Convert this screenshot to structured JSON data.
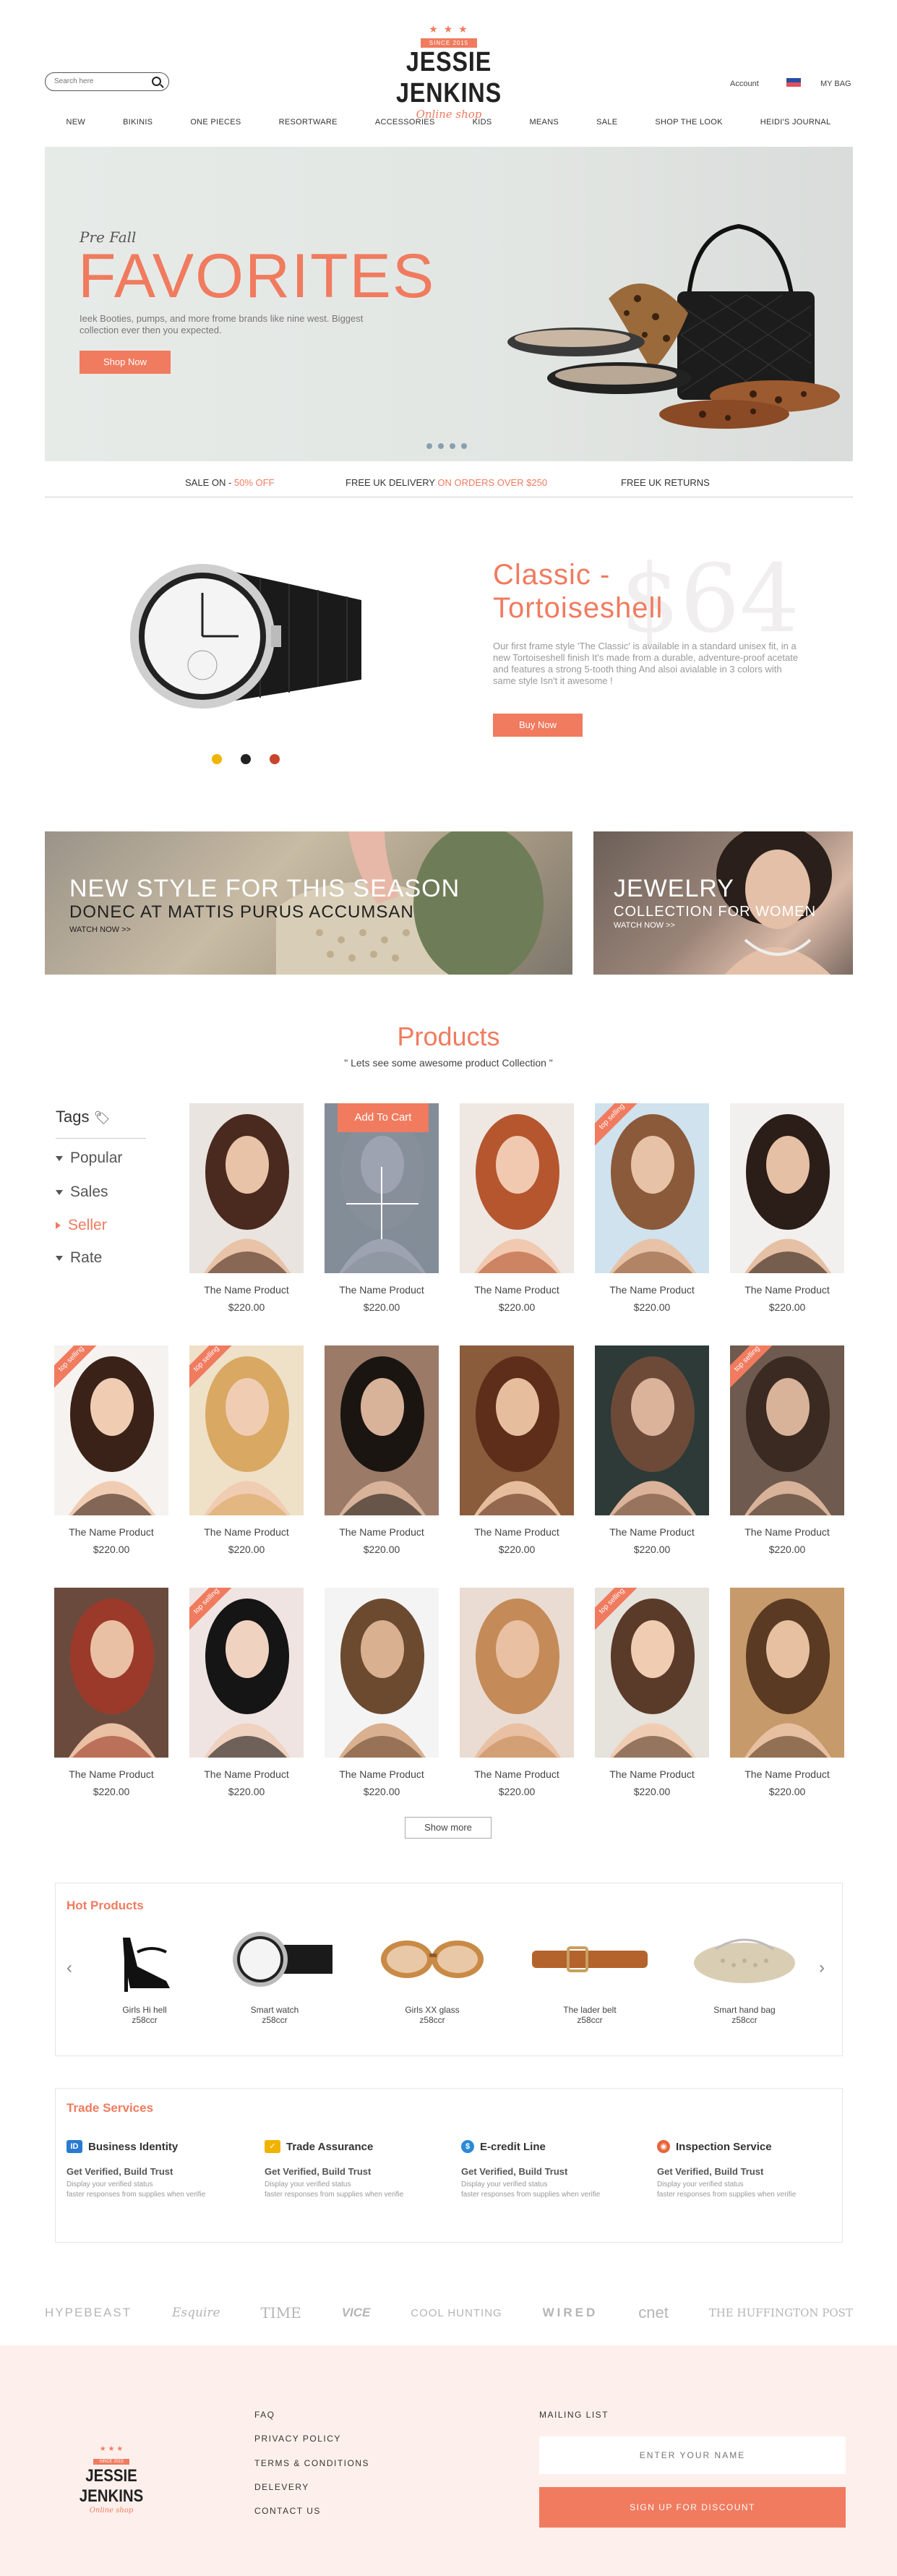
{
  "header": {
    "search_placeholder": "Search here",
    "logo": {
      "ribbon": "SINCE 2015",
      "name": "JESSIE JENKINS",
      "sub": "Online shop"
    },
    "account": "Account",
    "my_bag": "MY BAG"
  },
  "nav": [
    "NEW",
    "BIKINIS",
    "ONE PIECES",
    "RESORTWARE",
    "ACCESSORIES",
    "KIDS",
    "MEANS",
    "SALE",
    "SHOP THE LOOK",
    "HEIDI'S JOURNAL"
  ],
  "hero": {
    "pre": "Pre Fall",
    "title": "FAVORITES",
    "desc": "Ieek Booties, pumps, and more frome brands like nine west. Biggest collection ever then you expected.",
    "cta": "Shop Now"
  },
  "strip": {
    "sale_label": "SALE ON - ",
    "sale_value": "50% OFF",
    "delivery_label": "FREE UK DELIVERY ",
    "delivery_value": "ON ORDERS OVER $250",
    "returns": "FREE UK RETURNS"
  },
  "feature": {
    "title_line1": "Classic -",
    "title_line2": "Tortoiseshell",
    "price": "$64",
    "desc": "Our first frame style 'The Classic' is available in a standard unisex fit, in a new Tortoiseshell finish It's made from a durable, adventure-proof acetate and features a strong 5-tooth thing And alsoi avialable in 3 colors with same style Isn't it awesome !",
    "cta": "Buy Now",
    "colors": [
      "#f0b400",
      "#222222",
      "#c8442a"
    ]
  },
  "banners": {
    "left": {
      "title": "NEW STYLE FOR THIS SEASON",
      "sub": "DONEC AT MATTIS PURUS ACCUMSAN",
      "link": "WATCH NOW >>"
    },
    "right": {
      "title": "JEWELRY",
      "sub": "COLLECTION FOR WOMEN",
      "link": "WATCH NOW >>"
    }
  },
  "products": {
    "title": "Products",
    "subtitle": "\" Lets see some awesome product Collection \"",
    "tags_heading": "Tags",
    "tags": [
      "Popular",
      "Sales",
      "Seller",
      "Rate"
    ],
    "active_tag": "Seller",
    "add_to_cart": "Add To Cart",
    "top_label": "top selling",
    "item_name": "The Name Product",
    "item_price": "$220.00",
    "show_more": "Show more"
  },
  "hot": {
    "title": "Hot Products",
    "items": [
      {
        "name": "Girls Hi hell",
        "price": "z58ccr"
      },
      {
        "name": "Smart watch",
        "price": "z58ccr"
      },
      {
        "name": "Girls XX glass",
        "price": "z58ccr"
      },
      {
        "name": "The lader belt",
        "price": "z58ccr"
      },
      {
        "name": "Smart hand bag",
        "price": "z58ccr"
      }
    ]
  },
  "trade": {
    "title": "Trade Services",
    "items": [
      {
        "heading": "Business Identity",
        "icon": "id-card-icon",
        "tag": "Get Verified, Build Trust",
        "d1": "Display your verified status",
        "d2": "faster responses from supplies when verifie"
      },
      {
        "heading": "Trade Assurance",
        "icon": "shield-icon",
        "tag": "Get Verified, Build Trust",
        "d1": "Display your verified status",
        "d2": "faster responses from supplies when verifie"
      },
      {
        "heading": "E-credit Line",
        "icon": "money-bag-icon",
        "tag": "Get Verified, Build Trust",
        "d1": "Display your verified status",
        "d2": "faster responses from supplies when verifie"
      },
      {
        "heading": "Inspection Service",
        "icon": "inspection-icon",
        "tag": "Get Verified, Build Trust",
        "d1": "Display your verified status",
        "d2": "faster responses from supplies when verifie"
      }
    ]
  },
  "brands": [
    "HYPEBEAST",
    "Esquire",
    "TIME",
    "VICE",
    "COOL HUNTING",
    "WIRED",
    "cnet",
    "THE HUFFINGTON POST"
  ],
  "footer": {
    "links": [
      "FAQ",
      "PRIVACY POLICY",
      "TERMS & CONDITIONS",
      "DELEVERY",
      "CONTACT US"
    ],
    "mailing_heading": "MAILING LIST",
    "name_placeholder": "ENTER YOUR NAME",
    "signup": "SIGN UP FOR DISCOUNT"
  },
  "colors": {
    "accent": "#f07b5f",
    "footer_bg": "#fdf0ec"
  }
}
